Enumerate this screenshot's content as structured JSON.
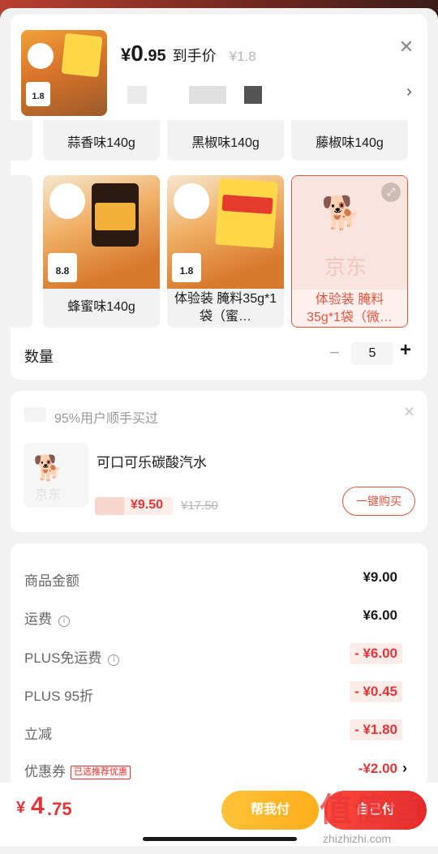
{
  "product": {
    "price_yen": "¥",
    "price_int": "0",
    "price_dec": ".95",
    "price_label": "到手价",
    "original_price": "¥1.8",
    "thumb_badge": "1.8"
  },
  "variants": [
    {
      "label": "蒜香味140g",
      "selected": false
    },
    {
      "label": "黑椒味140g",
      "selected": false
    },
    {
      "label": "藤椒味140g",
      "selected": false
    },
    {
      "label": "蜂蜜味140g",
      "badge": "8.8",
      "selected": false
    },
    {
      "label": "体验装 腌料35g*1袋（蜜…",
      "badge": "1.8",
      "selected": false
    },
    {
      "label": "体验装 腌料35g*1袋（微…",
      "selected": true,
      "placeholder_text": "京东"
    }
  ],
  "quantity": {
    "label": "数量",
    "value": "5",
    "minus": "−",
    "plus": "+"
  },
  "upsell": {
    "title": "95%用户顺手买过",
    "item_name": "可口可乐碳酸汽水",
    "price": "¥9.50",
    "original_price": "¥17.50",
    "buy_label": "一键购买",
    "thumb_text": "京东"
  },
  "summary": {
    "rows": [
      {
        "label": "商品金额",
        "value": "¥9.00"
      },
      {
        "label": "运费",
        "value": "¥6.00"
      },
      {
        "label": "PLUS免运费",
        "value": "- ¥6.00"
      },
      {
        "label": "PLUS 95折",
        "value": "- ¥0.45"
      },
      {
        "label": "立减",
        "value": "- ¥1.80"
      }
    ],
    "coupon": {
      "label": "优惠券",
      "badge": "已选推荐优惠",
      "value": "-¥2.00"
    }
  },
  "bottom": {
    "total_yen": "¥",
    "total_int": "4",
    "total_dec": ".75",
    "help_pay_label": "帮我付",
    "self_pay_label": "自己付"
  },
  "watermark": {
    "logo": "值值值",
    "site": "zhizhizhi.com"
  },
  "colors": {
    "accent_red": "#e5353a",
    "accent_orange": "#ffb12a",
    "selected_border": "#e5553f"
  }
}
